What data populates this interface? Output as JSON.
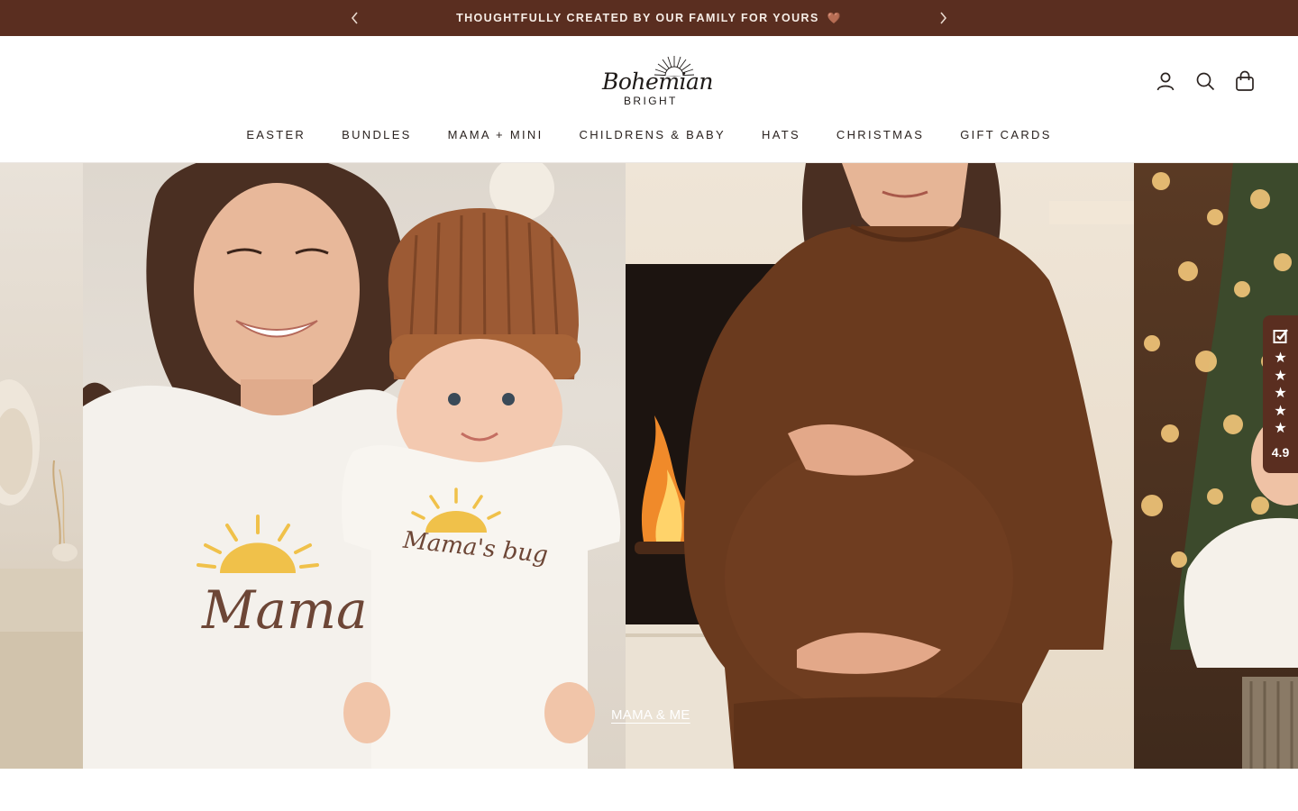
{
  "announcement": {
    "message": "THOUGHTFULLY CREATED BY OUR FAMILY FOR YOURS",
    "heart": "🤎",
    "prev_icon": "chevron-left-icon",
    "next_icon": "chevron-right-icon"
  },
  "brand": {
    "name_script": "Bohemian",
    "name_sub": "BRIGHT"
  },
  "header_icons": [
    "account-icon",
    "search-icon",
    "cart-icon"
  ],
  "nav": {
    "items": [
      "EASTER",
      "BUNDLES",
      "MAMA + MINI",
      "CHILDRENS & BABY",
      "HATS",
      "CHRISTMAS",
      "GIFT CARDS"
    ]
  },
  "hero": {
    "label": "MAMA & ME",
    "shirt_text_mama": "Mama",
    "shirt_text_bug": "Mama's bug"
  },
  "reviews_badge": {
    "score": "4.9",
    "stars": 5,
    "icon": "verified-check-icon"
  },
  "colors": {
    "brand_brown": "#5a2e20",
    "text": "#2b2320",
    "background": "#ffffff"
  }
}
